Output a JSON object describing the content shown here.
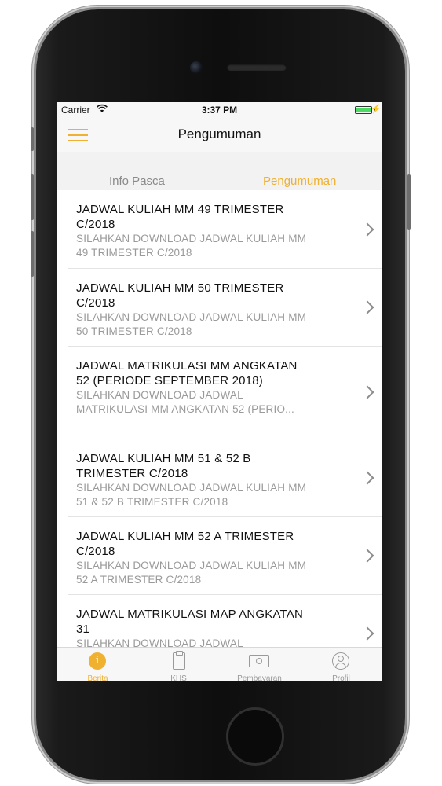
{
  "status_bar": {
    "carrier": "Carrier",
    "wifi_icon": "wifi-icon",
    "time": "3:37 PM",
    "battery_level": 1.0
  },
  "nav": {
    "title": "Pengumuman",
    "menu_icon": "hamburger-menu-icon"
  },
  "segments": {
    "left": "Info Pasca",
    "right": "Pengumuman",
    "active": "right"
  },
  "announcements": [
    {
      "title": "JADWAL KULIAH MM 49 TRIMESTER C/2018",
      "subtitle": "SILAHKAN DOWNLOAD JADWAL KULIAH MM 49 TRIMESTER C/2018"
    },
    {
      "title": "JADWAL KULIAH MM 50 TRIMESTER C/2018",
      "subtitle": "SILAHKAN DOWNLOAD JADWAL KULIAH MM 50 TRIMESTER C/2018"
    },
    {
      "title": "JADWAL MATRIKULASI MM ANGKATAN 52 (PERIODE SEPTEMBER 2018)",
      "subtitle": "SILAHKAN DOWNLOAD JADWAL MATRIKULASI MM ANGKATAN 52 (PERIO..."
    },
    {
      "title": "JADWAL KULIAH MM 51 & 52 B TRIMESTER C/2018",
      "subtitle": "SILAHKAN DOWNLOAD JADWAL KULIAH MM 51 & 52 B TRIMESTER C/2018"
    },
    {
      "title": "JADWAL KULIAH MM 52 A TRIMESTER C/2018",
      "subtitle": "SILAHKAN DOWNLOAD JADWAL KULIAH MM 52 A TRIMESTER C/2018"
    },
    {
      "title": "JADWAL MATRIKULASI MAP ANGKATAN 31",
      "subtitle": "SILAHKAN DOWNLOAD JADWAL"
    }
  ],
  "tabbar": {
    "tabs": [
      {
        "label": "Berita",
        "icon": "info-icon",
        "active": true
      },
      {
        "label": "KHS",
        "icon": "clipboard-icon",
        "active": false
      },
      {
        "label": "Pembayaran",
        "icon": "payment-icon",
        "active": false
      },
      {
        "label": "Profil",
        "icon": "profile-icon",
        "active": false
      }
    ]
  },
  "colors": {
    "accent": "#f0b030",
    "battery": "#4cd964",
    "muted_text": "#9a9a9a"
  }
}
